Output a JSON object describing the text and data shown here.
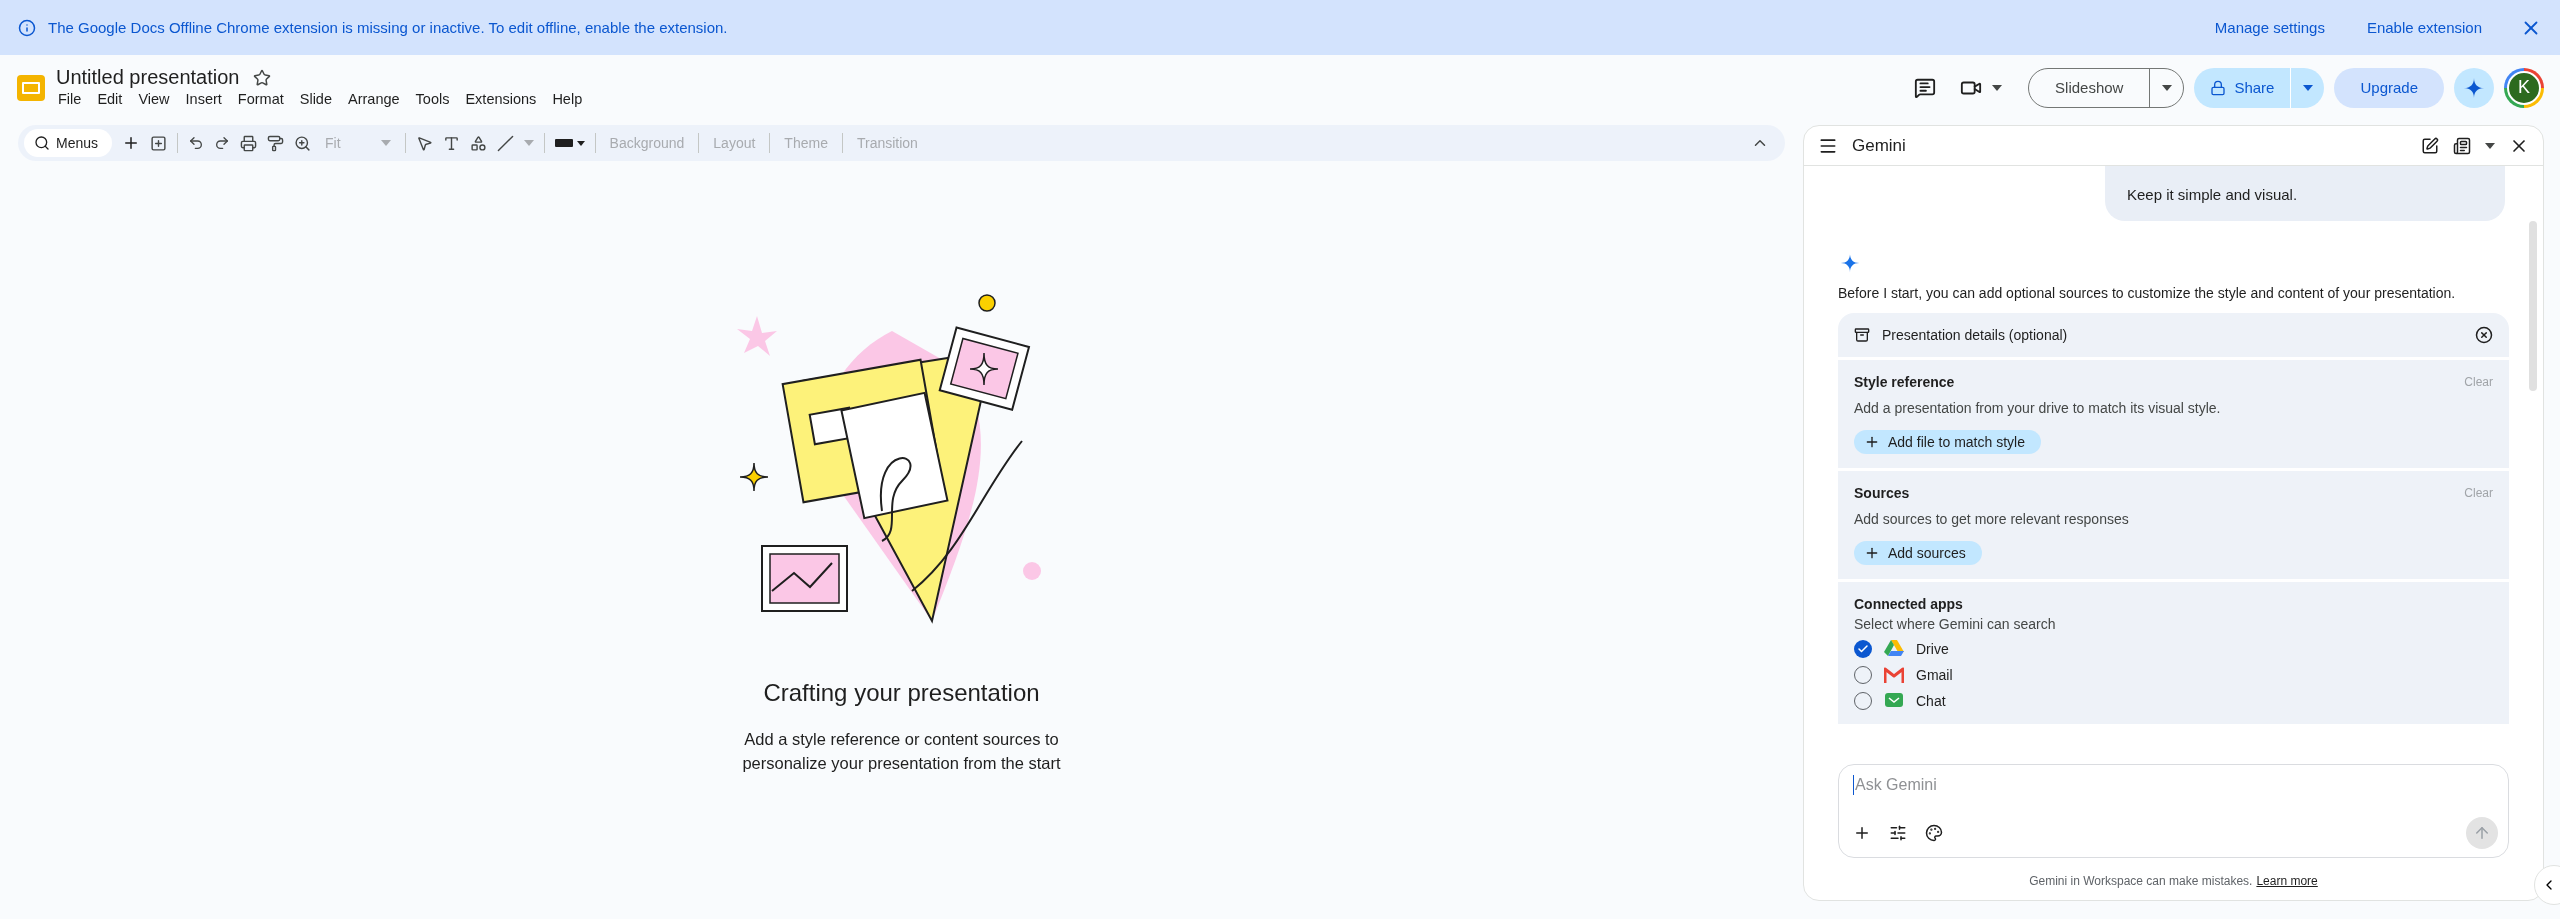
{
  "banner": {
    "message": "The Google Docs Offline Chrome extension is missing or inactive. To edit offline, enable the extension.",
    "actions": [
      "Manage settings",
      "Enable extension"
    ]
  },
  "document": {
    "title": "Untitled presentation",
    "starred": false
  },
  "menu": [
    "File",
    "Edit",
    "View",
    "Insert",
    "Format",
    "Slide",
    "Arrange",
    "Tools",
    "Extensions",
    "Help"
  ],
  "header": {
    "slideshow": "Slideshow",
    "share": "Share",
    "upgrade": "Upgrade",
    "avatar": "K"
  },
  "toolbar": {
    "search": "Menus",
    "zoom": {
      "label": "Fit",
      "disabled": true
    },
    "actions": [
      {
        "label": "Background",
        "disabled": true
      },
      {
        "label": "Layout",
        "disabled": true
      },
      {
        "label": "Theme",
        "disabled": true
      },
      {
        "label": "Transition",
        "disabled": true
      }
    ]
  },
  "canvas": {
    "title": "Crafting your presentation",
    "subtitle": "Add a style reference or content sources to personalize your presentation from the start"
  },
  "gemini": {
    "title": "Gemini",
    "message": "Keep it simple and visual.",
    "intro": "Before I start, you can add optional sources to customize the style and content of your presentation.",
    "details_title": "Presentation details (optional)",
    "sections": [
      {
        "kind": "upload",
        "title": "Style reference",
        "clear": "Clear",
        "description": "Add a presentation from your drive to match its visual style.",
        "button": "Add file to match style"
      },
      {
        "kind": "upload",
        "title": "Sources",
        "clear": "Clear",
        "description": "Add sources to get more relevant responses",
        "button": "Add sources"
      },
      {
        "kind": "apps",
        "title": "Connected apps",
        "description": "Select where Gemini can search",
        "apps": [
          {
            "kind": "drive",
            "name": "Drive",
            "selected": true
          },
          {
            "kind": "gmail",
            "name": "Gmail",
            "selected": false
          },
          {
            "kind": "chat",
            "name": "Chat",
            "selected": false
          }
        ]
      }
    ],
    "input": {
      "placeholder": "Ask Gemini"
    },
    "footer": {
      "text": "Gemini in Workspace can make mistakes.",
      "link": "Learn more"
    }
  }
}
